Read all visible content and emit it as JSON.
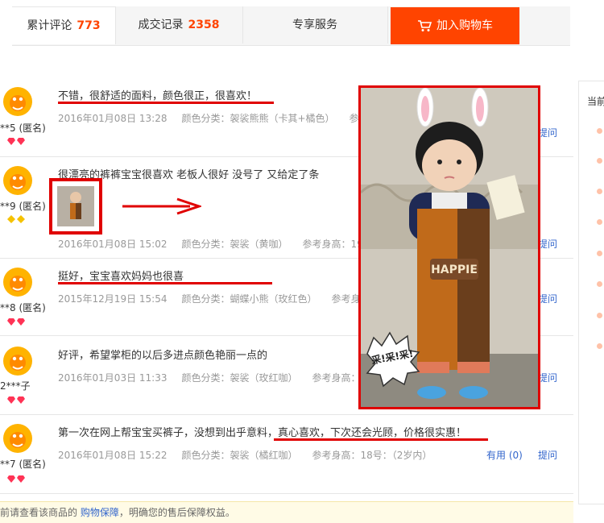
{
  "tabs": [
    {
      "label": "累计评论",
      "count": "773"
    },
    {
      "label": "成交记录",
      "count": "2358"
    },
    {
      "label": "专享服务"
    }
  ],
  "cart_button": "加入购物车",
  "sidebar_label": "当前",
  "reviews": [
    {
      "user": "**5 (匿名)",
      "content": "不错，很舒适的面料，颜色很正，很喜欢！",
      "date": "2016年01月08日 13:28",
      "sku": "颜色分类：袈裟熊熊（卡其+橘色）",
      "height": "参考身",
      "ask": "提问"
    },
    {
      "user": "**9 (匿名)",
      "content": "很漂亮的裤裤宝宝很喜欢 老板人很好 没号了 又给定了条",
      "date": "2016年01月08日 15:02",
      "sku": "颜色分类：袈裟（黄咖）",
      "height": "参考身高：19号",
      "ask": "提问"
    },
    {
      "user": "**8 (匿名)",
      "content": "挺好，宝宝喜欢妈妈也很喜",
      "date": "2015年12月19日 15:54",
      "sku": "颜色分类：蝴蝶小熊（玫红色）",
      "height": "参考身高",
      "ask": "提问"
    },
    {
      "user": "2***子",
      "content": "好评，希望掌柜的以后多进点颜色艳丽一点的",
      "date": "2016年01月03日 11:33",
      "sku": "颜色分类：袈裟（玫红咖）",
      "height": "参考身高：",
      "ask": "提问"
    },
    {
      "user": "**7 (匿名)",
      "content": "第一次在网上帮宝宝买裤子，没想到出乎意料，真心喜欢，下次还会光顾，价格很实惠！",
      "date": "2016年01月08日 15:22",
      "sku": "颜色分类：袈裟（橘红咖）",
      "height": "参考身高：18号：（2岁内）",
      "useful": "有用 (0)",
      "ask": "提问"
    }
  ],
  "photo": {
    "caption_text": "HAPPIE",
    "sticker_text": "采!采!采!"
  },
  "notice": {
    "before": "前请查看该商品的 ",
    "link": "购物保障",
    "after": "，明确您的售后保障权益。"
  },
  "colors": {
    "accent": "#ff4400",
    "highlight": "#e00000",
    "link": "#3366cc"
  }
}
